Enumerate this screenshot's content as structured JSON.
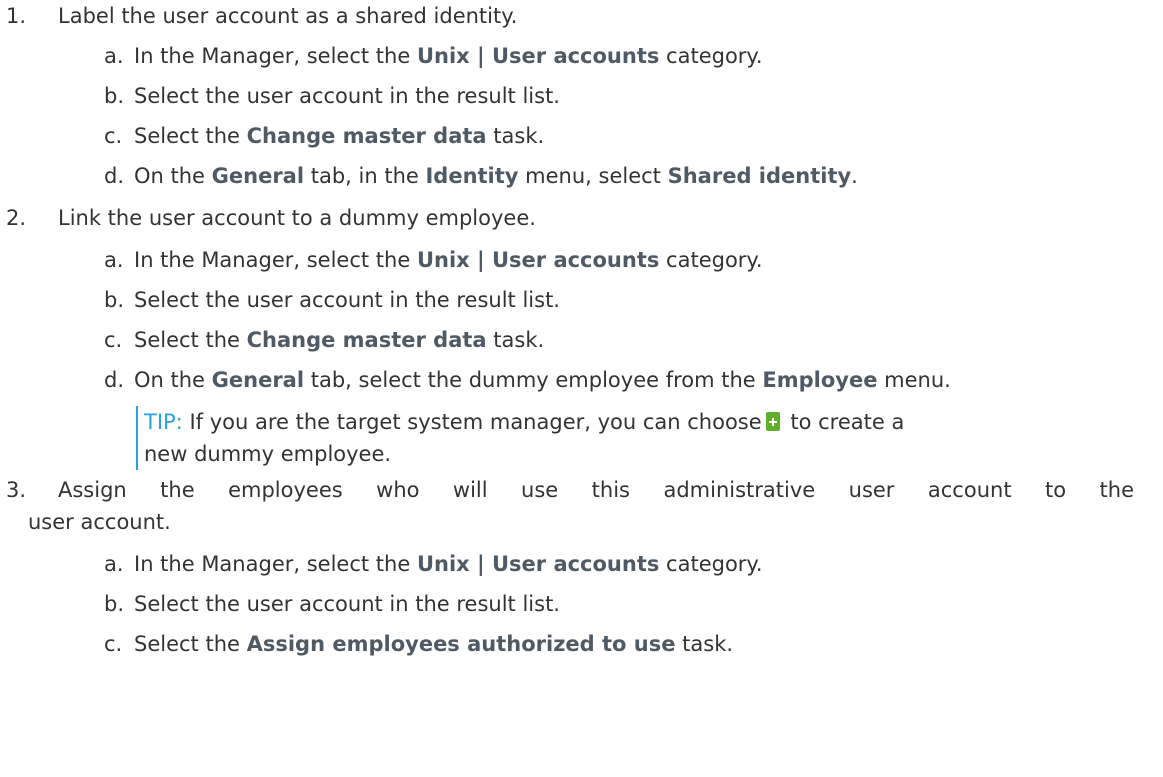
{
  "steps": [
    {
      "number": "1.",
      "text": "Label the user account as a shared identity.",
      "substeps": [
        {
          "letter": "a.",
          "pre": "In the Manager, select the ",
          "bold": "Unix | User accounts",
          "post": " category."
        },
        {
          "letter": "b.",
          "pre": "Select the user account in the result list."
        },
        {
          "letter": "c.",
          "pre": "Select the ",
          "bold": "Change master data",
          "post": " task."
        },
        {
          "letter": "d.",
          "pre": "On the ",
          "bold": "General",
          "mid": " tab, in the ",
          "bold2": "Identity",
          "mid2": " menu, select ",
          "bold3": "Shared identity",
          "post": "."
        }
      ]
    },
    {
      "number": "2.",
      "text": "Link the user account to a dummy employee.",
      "substeps": [
        {
          "letter": "a.",
          "pre": "In the Manager, select the ",
          "bold": "Unix | User accounts",
          "post": " category."
        },
        {
          "letter": "b.",
          "pre": "Select the user account in the result list."
        },
        {
          "letter": "c.",
          "pre": "Select the ",
          "bold": "Change master data",
          "post": " task."
        },
        {
          "letter": "d.",
          "pre": "On the ",
          "bold": "General",
          "mid": " tab, select the dummy employee from the ",
          "bold2": "Employee",
          "post": " menu."
        }
      ],
      "tip": {
        "label": "TIP:",
        "pre": " If you are the target system manager, you can choose",
        "post": " to create a",
        "line2": "new dummy employee."
      }
    },
    {
      "number": "3.",
      "text": "Assign the employees who will use this administrative user account to the",
      "text2": "user account.",
      "substeps": [
        {
          "letter": "a.",
          "pre": "In the Manager, select the ",
          "bold": "Unix | User accounts",
          "post": " category."
        },
        {
          "letter": "b.",
          "pre": "Select the user account in the result list."
        },
        {
          "letter": "c.",
          "pre": "Select the ",
          "bold": "Assign employees authorized to use",
          "post": " task."
        }
      ]
    }
  ],
  "colors": {
    "text": "#333333",
    "bold": "#505a64",
    "tip_accent": "#29a3dc",
    "add_icon": "#5fae2c"
  },
  "icons": {
    "add": "add-icon"
  }
}
